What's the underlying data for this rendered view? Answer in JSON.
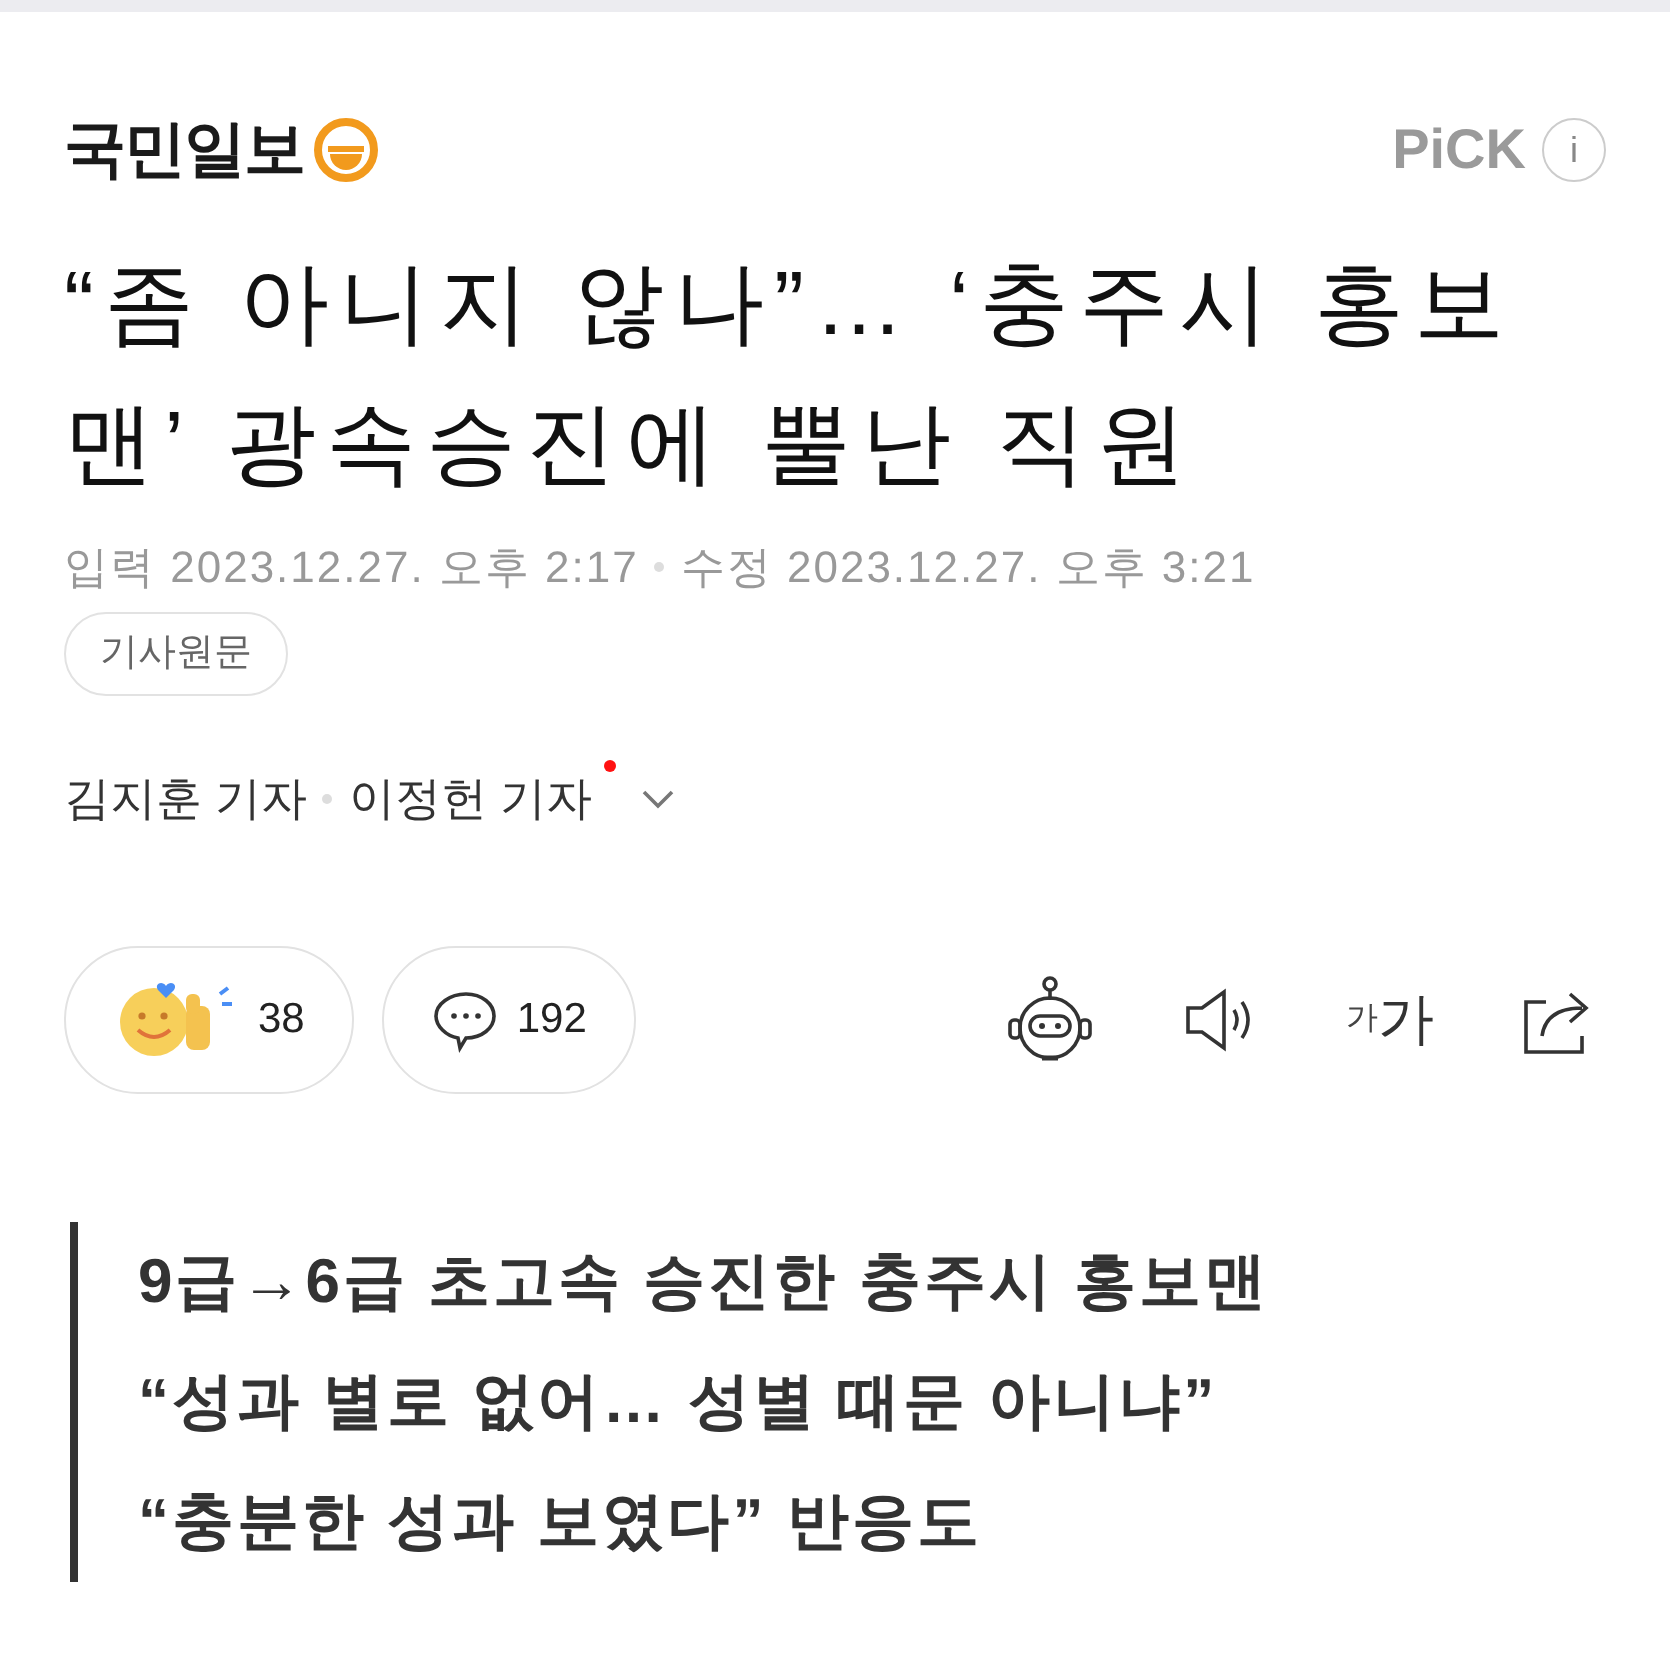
{
  "header": {
    "logo_text": "국민일보",
    "pick_label": "PiCK",
    "info_glyph": "i"
  },
  "headline": "“좀 아니지 않나”… ‘충주시 홍보맨’ 광속승진에 뿔난 직원",
  "meta": [
    {
      "label": "입력",
      "datetime": "2023.12.27. 오후 2:17"
    },
    {
      "label": "수정",
      "datetime": "2023.12.27. 오후 3:21"
    }
  ],
  "original_button": "기사원문",
  "authors": [
    {
      "name": "김지훈 기자",
      "alert": false
    },
    {
      "name": "이정헌 기자",
      "alert": true
    }
  ],
  "reactions": [
    {
      "kind": "like",
      "count": "38"
    },
    {
      "kind": "comment",
      "count": "192"
    }
  ],
  "tools": [
    {
      "kind": "bot"
    },
    {
      "kind": "speaker"
    },
    {
      "kind": "font",
      "small": "가",
      "large": "가"
    },
    {
      "kind": "share"
    }
  ],
  "summary": [
    "9급→6급 초고속 승진한 충주시 홍보맨",
    "“성과 별로 없어… 성별 때문 아니냐”",
    "“충분한 성과 보였다” 반응도"
  ]
}
